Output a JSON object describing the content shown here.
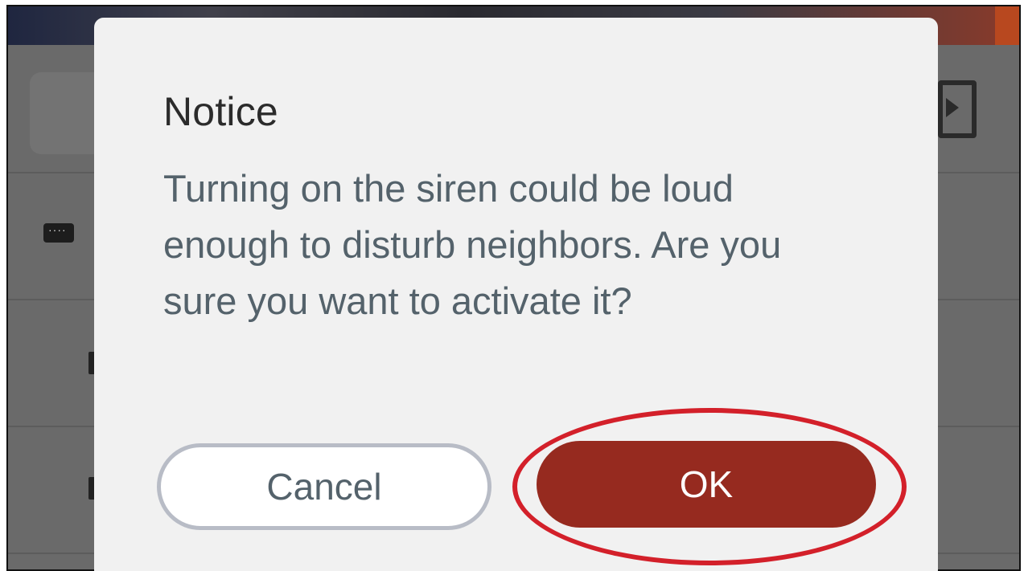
{
  "dialog": {
    "title": "Notice",
    "message": "Turning on the siren could be loud enough to disturb neighbors. Are you sure you want to activate it?",
    "cancel_label": "Cancel",
    "ok_label": "OK"
  },
  "background": {
    "icons": [
      "keyboard-icon",
      "video-film-icon"
    ]
  },
  "colors": {
    "ok_button": "#962a1f",
    "highlight": "#d3202a",
    "message_text": "#54626b"
  }
}
